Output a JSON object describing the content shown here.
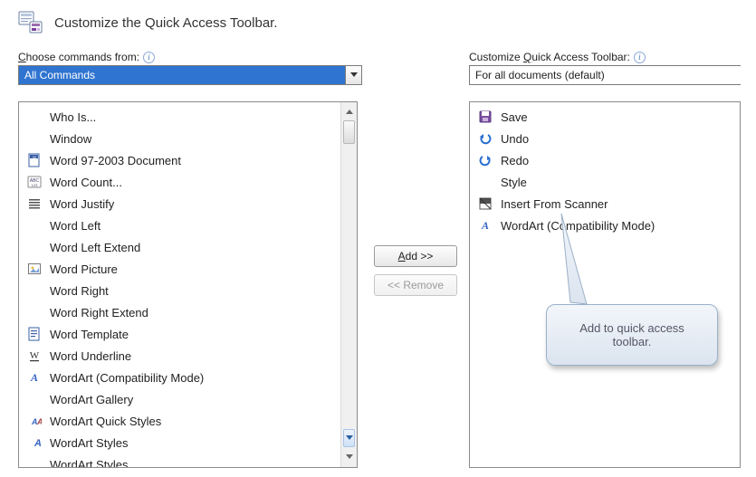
{
  "header": {
    "title": "Customize the Quick Access Toolbar."
  },
  "left": {
    "label_pre": "C",
    "label_post": "hoose commands from:",
    "combo_value": "All Commands",
    "items": [
      {
        "label": "Who Is...",
        "icon": "blank",
        "submenu": false
      },
      {
        "label": "Window",
        "icon": "blank",
        "submenu": true
      },
      {
        "label": "Word 97-2003 Document",
        "icon": "doc97",
        "submenu": false
      },
      {
        "label": "Word Count...",
        "icon": "abc123",
        "submenu": false
      },
      {
        "label": "Word Justify",
        "icon": "justify",
        "submenu": false
      },
      {
        "label": "Word Left",
        "icon": "blank",
        "submenu": false
      },
      {
        "label": "Word Left Extend",
        "icon": "blank",
        "submenu": false
      },
      {
        "label": "Word Picture",
        "icon": "picture",
        "submenu": false
      },
      {
        "label": "Word Right",
        "icon": "blank",
        "submenu": false
      },
      {
        "label": "Word Right Extend",
        "icon": "blank",
        "submenu": false
      },
      {
        "label": "Word Template",
        "icon": "template",
        "submenu": false
      },
      {
        "label": "Word Underline",
        "icon": "underline",
        "submenu": false
      },
      {
        "label": "WordArt (Compatibility Mode)",
        "icon": "wordart",
        "submenu": true
      },
      {
        "label": "WordArt Gallery",
        "icon": "blank",
        "submenu": false
      },
      {
        "label": "WordArt Quick Styles",
        "icon": "wa-styles",
        "submenu": true
      },
      {
        "label": "WordArt Styles",
        "icon": "wa-styles2",
        "submenu": true
      },
      {
        "label": "WordArt Styles",
        "icon": "blank",
        "submenu": true
      }
    ]
  },
  "mid": {
    "add_pre": "A",
    "add_post": "dd >>",
    "remove": "<< Remove"
  },
  "right": {
    "label_pre": "Customize ",
    "label_u": "Q",
    "label_post": "uick Access Toolbar:",
    "combo_value": "For all documents (default)",
    "items": [
      {
        "label": "Save",
        "icon": "save"
      },
      {
        "label": "Undo",
        "icon": "undo"
      },
      {
        "label": "Redo",
        "icon": "redo"
      },
      {
        "label": "Style",
        "icon": "blank"
      },
      {
        "label": "Insert From Scanner",
        "icon": "scanner"
      },
      {
        "label": "WordArt (Compatibility Mode)",
        "icon": "wordart"
      }
    ]
  },
  "callout": {
    "line1": "Add to quick access",
    "line2": "toolbar."
  }
}
